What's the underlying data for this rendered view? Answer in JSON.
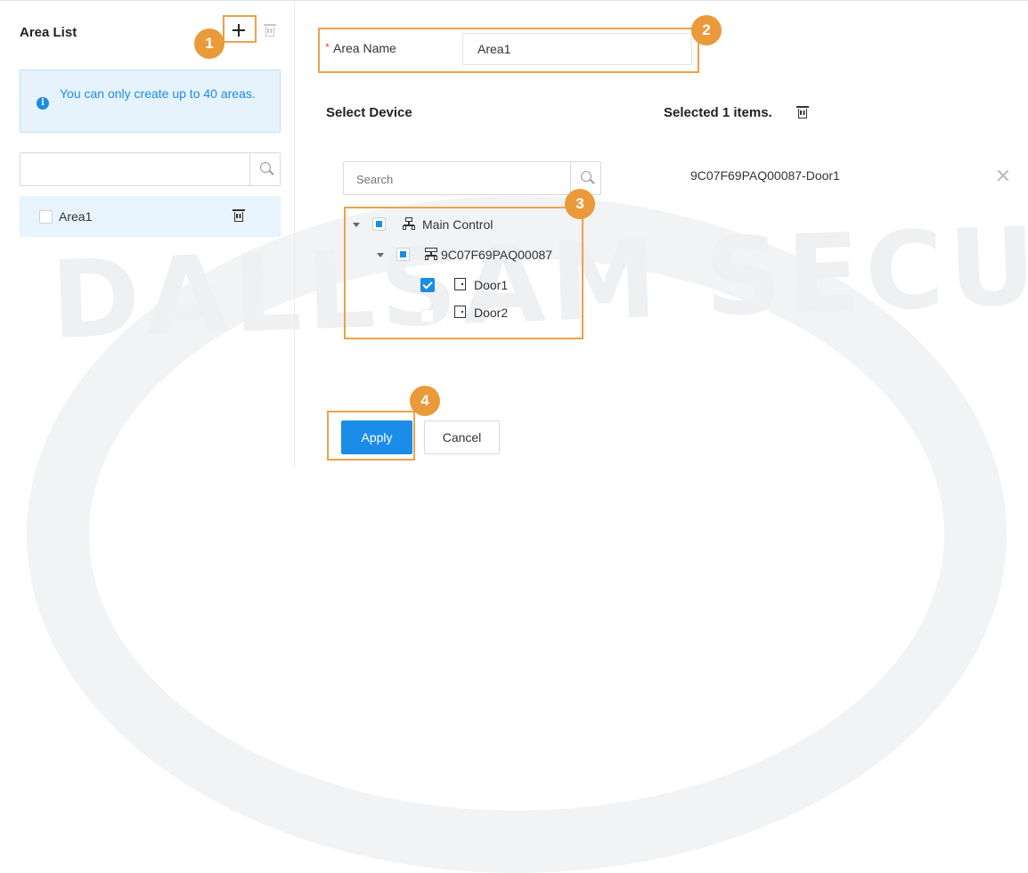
{
  "colors": {
    "accent": "#1b8ce8",
    "callout": "#ea9a3a",
    "highlight_border": "#eda249",
    "info_background": "#e6f3fd"
  },
  "watermark": "DALLSAM SECURITY",
  "area_list": {
    "title": "Area List",
    "add_icon": "plus-icon",
    "delete_icon": "trash-icon",
    "info_icon": "info-icon",
    "info_message": "You can only create up to 40 areas.",
    "search": {
      "placeholder": "",
      "icon": "search-icon"
    },
    "items": [
      {
        "label": "Area1",
        "checked": false,
        "delete_icon": "trash-icon"
      }
    ]
  },
  "form": {
    "area_name": {
      "required_mark": "*",
      "label": "Area Name",
      "value": "Area1"
    }
  },
  "select_device": {
    "title": "Select Device",
    "search": {
      "placeholder": "Search",
      "icon": "search-icon"
    },
    "tree": [
      {
        "label": "Main Control",
        "icon": "network-icon",
        "expanded": true,
        "state": "partial"
      },
      {
        "label": "9C07F69PAQ00087",
        "icon": "device-icon",
        "expanded": true,
        "state": "partial"
      },
      {
        "label": "Door1",
        "icon": "door-icon",
        "state": "checked"
      },
      {
        "label": "Door2",
        "icon": "door-icon",
        "state": "unchecked"
      }
    ]
  },
  "selected": {
    "title": "Selected 1 items.",
    "clear_icon": "trash-icon",
    "items": [
      {
        "label": "9C07F69PAQ00087-Door1",
        "remove_icon": "close-icon"
      }
    ]
  },
  "callouts": [
    "1",
    "2",
    "3",
    "4"
  ],
  "buttons": {
    "apply": "Apply",
    "cancel": "Cancel"
  }
}
